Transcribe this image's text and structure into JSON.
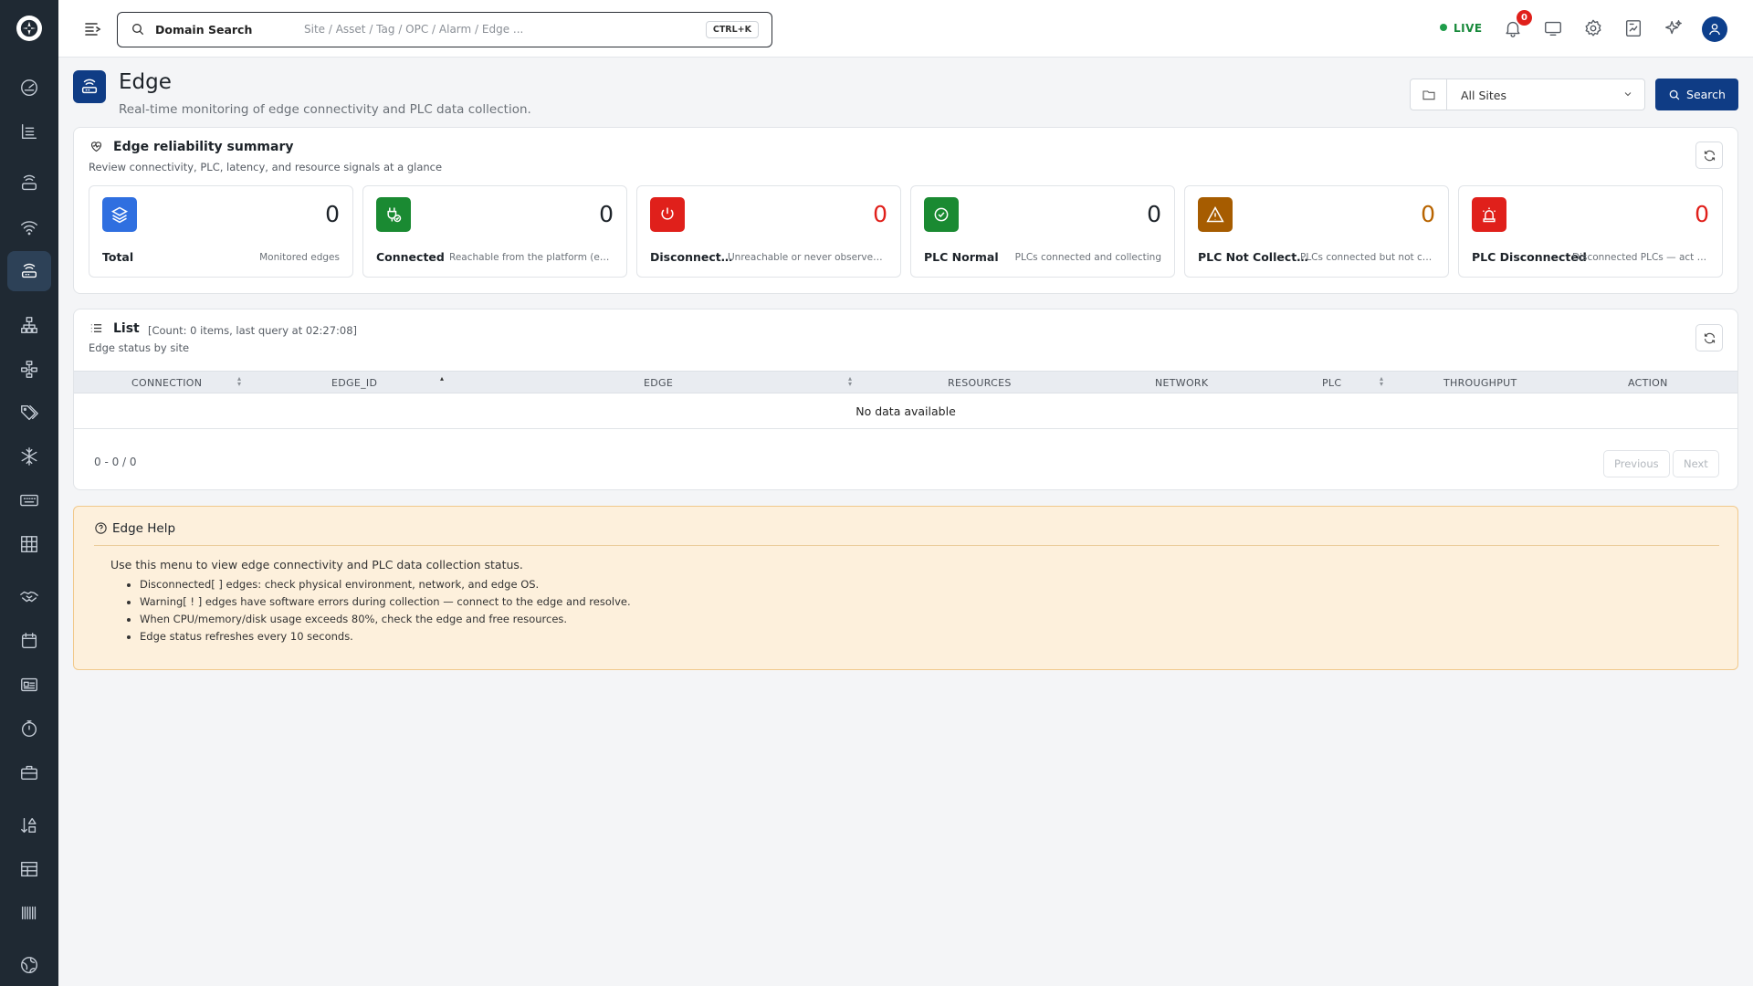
{
  "header": {
    "search_label": "Domain Search",
    "search_placeholder": "Site / Asset / Tag / OPC / Alarm / Edge ...",
    "shortcut": "CTRL+K",
    "live_label": "LIVE",
    "notification_count": "0"
  },
  "page": {
    "title": "Edge",
    "subtitle": "Real-time monitoring of edge connectivity and PLC data collection.",
    "site_filter": "All Sites",
    "search_button": "Search"
  },
  "summary": {
    "title": "Edge reliability summary",
    "subtitle": "Review connectivity, PLC, latency, and resource signals at a glance",
    "cards": [
      {
        "label": "Total",
        "value": "0",
        "desc": "Monitored edges",
        "icon_color": "#2f6fe0",
        "value_color": "#1d2329"
      },
      {
        "label": "Connected",
        "value": "0",
        "desc": "Reachable from the platform (edges)",
        "icon_color": "#1a8a32",
        "value_color": "#1d2329"
      },
      {
        "label": "Disconnect…",
        "value": "0",
        "desc": "Unreachable or never observed (ed…",
        "icon_color": "#e0201b",
        "value_color": "#e0201b"
      },
      {
        "label": "PLC Normal",
        "value": "0",
        "desc": "PLCs connected and collecting",
        "icon_color": "#1a8a32",
        "value_color": "#1d2329"
      },
      {
        "label": "PLC Not Collect…",
        "value": "0",
        "desc": "PLCs connected but not colle…",
        "icon_color": "#a65c00",
        "value_color": "#b86400"
      },
      {
        "label": "PLC Disconnected",
        "value": "0",
        "desc": "Disconnected PLCs — act now",
        "icon_color": "#e0201b",
        "value_color": "#e0201b"
      }
    ]
  },
  "list": {
    "title": "List",
    "count": "[Count: 0 items, last query at 02:27:08]",
    "subtitle": "Edge status by site",
    "columns": [
      "CONNECTION",
      "EDGE_ID",
      "EDGE",
      "RESOURCES",
      "NETWORK",
      "PLC",
      "THROUGHPUT",
      "ACTION"
    ],
    "empty_text": "No data available",
    "range": "0 - 0 / 0",
    "prev": "Previous",
    "next": "Next"
  },
  "help": {
    "title": "Edge Help",
    "intro": "Use this menu to view edge connectivity and PLC data collection status.",
    "items": [
      "Disconnected[ ] edges: check physical environment, network, and edge OS.",
      "Warning[ ! ] edges have software errors during collection — connect to the edge and resolve.",
      "When CPU/memory/disk usage exceeds 80%, check the edge and free resources.",
      "Edge status refreshes every 10 seconds."
    ]
  },
  "sidebar_icons": [
    "dashboard-icon",
    "list-icon",
    "router-icon",
    "wifi-icon",
    "edge-icon",
    "hierarchy-icon",
    "network-icon",
    "tags-icon",
    "snowflake-icon",
    "keyboard-icon",
    "grid-icon",
    "handshake-icon",
    "calendar-icon",
    "id-card-icon",
    "stopwatch-icon",
    "toolbox-icon",
    "sort-shapes-icon",
    "table-icon",
    "barcode-icon",
    "globe-icon"
  ]
}
